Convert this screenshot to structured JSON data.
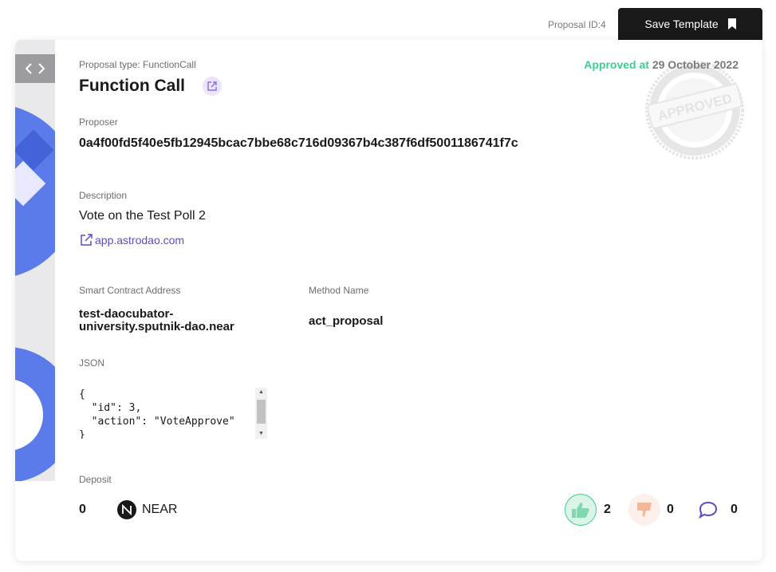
{
  "header": {
    "proposal_id": "Proposal ID:4",
    "save_template_label": "Save Template"
  },
  "proposal": {
    "type_label": "Proposal type: FunctionCall",
    "title": "Function Call",
    "approved_prefix": "Approved at",
    "approved_date": "29 October 2022",
    "stamp_text": "APPROVED",
    "proposer_label": "Proposer",
    "proposer_value": "0a4f00fd5f40e5fb12945bcac7bbe68c716d09367b4c387f6df5001186741f7c",
    "description_label": "Description",
    "description_text": "Vote on the Test Poll 2",
    "description_link": "app.astrodao.com",
    "smart_contract_label": "Smart Contract Address",
    "smart_contract_value": "test-daocubator-university.sputnik-dao.near",
    "method_label": "Method Name",
    "method_value": "act_proposal",
    "json_label": "JSON",
    "json_value": "{\n  \"id\": 3,\n  \"action\": \"VoteApprove\"\n}",
    "deposit_label": "Deposit",
    "deposit_amount": "0",
    "deposit_token": "NEAR"
  },
  "votes": {
    "yes_count": "2",
    "no_count": "0",
    "comment_count": "0"
  },
  "colors": {
    "accent_dark": "#19191a",
    "approved_green": "#3ccf8e",
    "link_purple": "#5a4ec6",
    "flag_blue": "#5b7bea"
  },
  "icons": {
    "bookmark": "bookmark-icon",
    "code": "code-icon",
    "external_link": "external-link-icon",
    "like": "thumbs-up-icon",
    "dislike": "thumbs-down-icon",
    "comment": "comment-icon",
    "near": "near-logo-icon"
  }
}
